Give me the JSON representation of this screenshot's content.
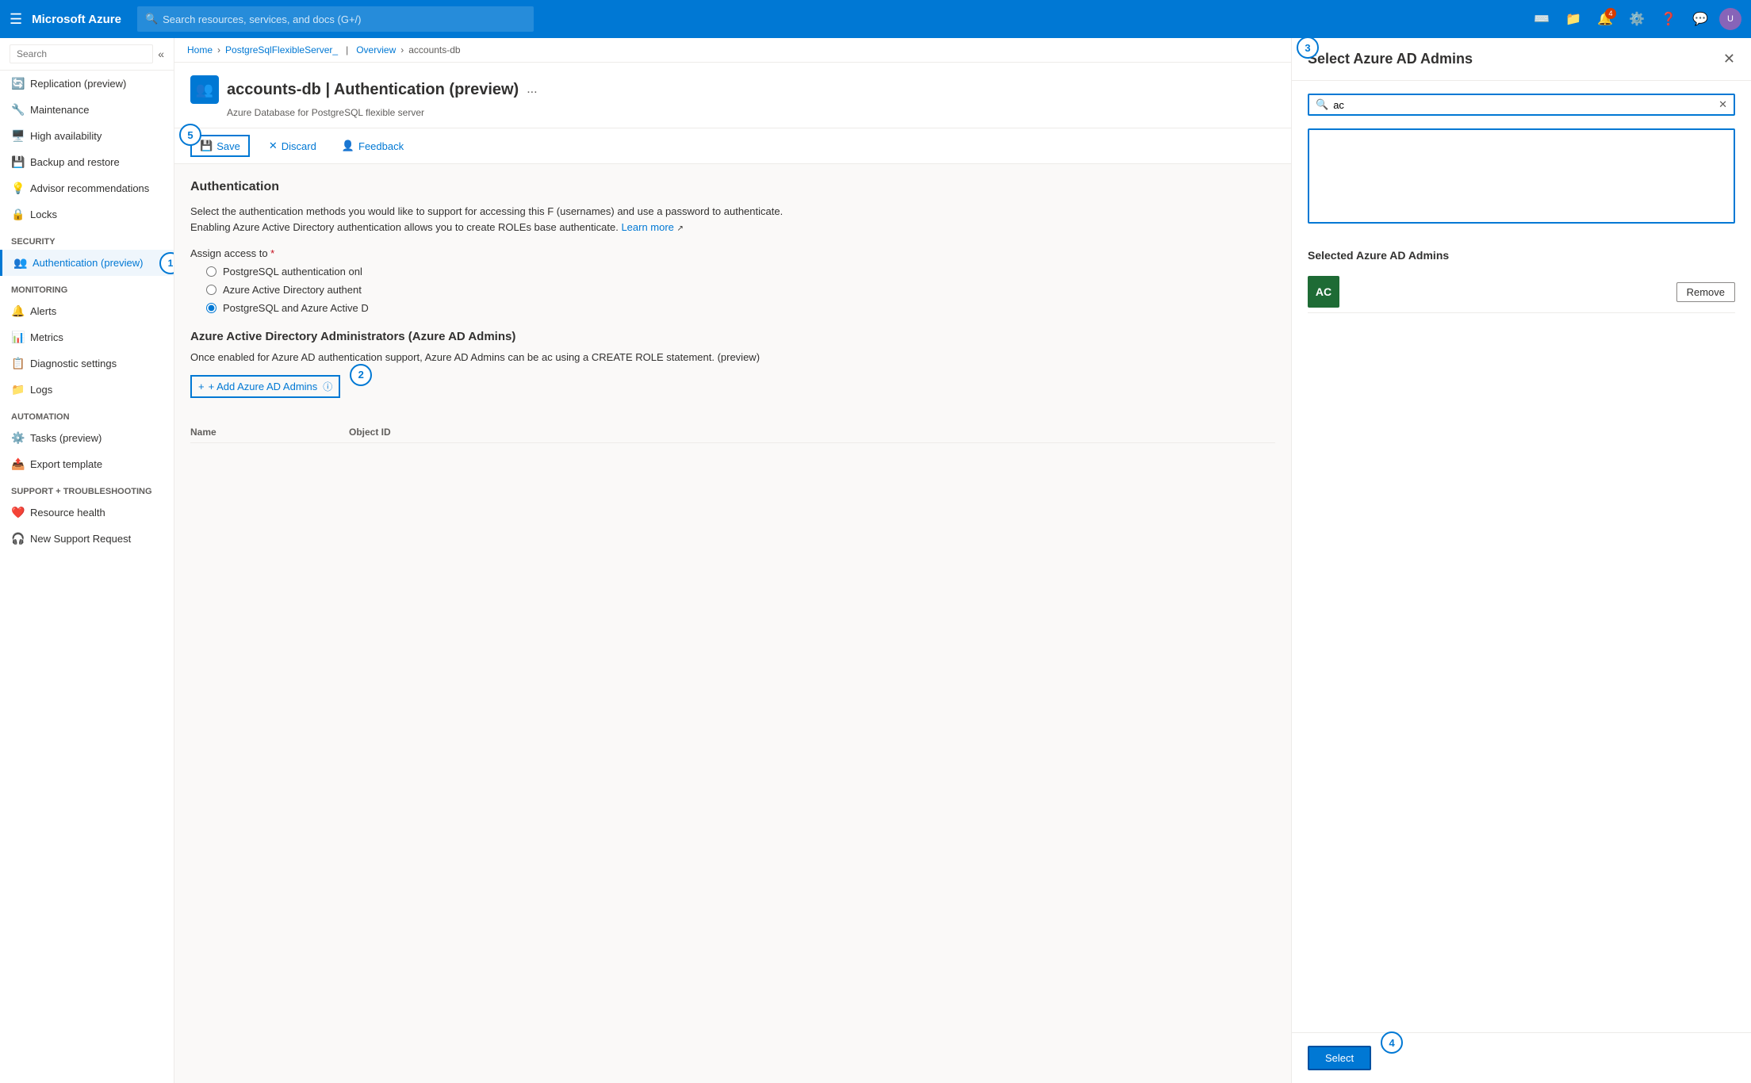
{
  "topnav": {
    "brand": "Microsoft Azure",
    "search_placeholder": "Search resources, services, and docs (G+/)",
    "notification_count": "4"
  },
  "breadcrumb": {
    "home": "Home",
    "server": "PostgreSqlFlexibleServer_",
    "overview": "Overview",
    "db": "accounts-db"
  },
  "resource": {
    "title": "accounts-db | Authentication (preview)",
    "subtitle": "Azure Database for PostgreSQL flexible server",
    "more_label": "..."
  },
  "toolbar": {
    "save_label": "Save",
    "discard_label": "Discard",
    "feedback_label": "Feedback"
  },
  "sidebar": {
    "search_placeholder": "Search",
    "items_top": [
      {
        "id": "replication",
        "label": "Replication (preview)",
        "icon": "🔄"
      },
      {
        "id": "maintenance",
        "label": "Maintenance",
        "icon": "🔧"
      },
      {
        "id": "high-availability",
        "label": "High availability",
        "icon": "🖥️"
      },
      {
        "id": "backup",
        "label": "Backup and restore",
        "icon": "💾"
      },
      {
        "id": "advisor",
        "label": "Advisor recommendations",
        "icon": "💡"
      },
      {
        "id": "locks",
        "label": "Locks",
        "icon": "🔒"
      }
    ],
    "security_section": "Security",
    "security_items": [
      {
        "id": "authentication",
        "label": "Authentication (preview)",
        "icon": "👥",
        "active": true
      }
    ],
    "monitoring_section": "Monitoring",
    "monitoring_items": [
      {
        "id": "alerts",
        "label": "Alerts",
        "icon": "🔔"
      },
      {
        "id": "metrics",
        "label": "Metrics",
        "icon": "📊"
      },
      {
        "id": "diagnostic",
        "label": "Diagnostic settings",
        "icon": "📋"
      },
      {
        "id": "logs",
        "label": "Logs",
        "icon": "📁"
      }
    ],
    "automation_section": "Automation",
    "automation_items": [
      {
        "id": "tasks",
        "label": "Tasks (preview)",
        "icon": "⚙️"
      },
      {
        "id": "export",
        "label": "Export template",
        "icon": "📤"
      }
    ],
    "support_section": "Support + troubleshooting",
    "support_items": [
      {
        "id": "resource-health",
        "label": "Resource health",
        "icon": "❤️"
      },
      {
        "id": "support",
        "label": "New Support Request",
        "icon": "🎧"
      }
    ]
  },
  "authentication": {
    "section_title": "Authentication",
    "desc1": "Select the authentication methods you would like to support for accessing this F (usernames) and use a password to authenticate.",
    "desc2": "Enabling Azure Active Directory authentication allows you to create ROLEs base authenticate.",
    "learn_more": "Learn more",
    "assign_label": "Assign access to",
    "radio_options": [
      {
        "id": "pg-only",
        "label": "PostgreSQL authentication onl",
        "checked": false
      },
      {
        "id": "aad-only",
        "label": "Azure Active Directory authent",
        "checked": false
      },
      {
        "id": "both",
        "label": "PostgreSQL and Azure Active D",
        "checked": true
      }
    ],
    "ad_section_title": "Azure Active Directory Administrators (Azure AD Admins)",
    "ad_desc": "Once enabled for Azure AD authentication support, Azure AD Admins can be ac using a CREATE ROLE statement. (preview)",
    "add_admin_label": "+ Add Azure AD Admins",
    "table_name_col": "Name",
    "table_objid_col": "Object ID"
  },
  "ad_panel": {
    "title": "Select Azure AD Admins",
    "search_value": "ac",
    "selected_title": "Selected Azure AD Admins",
    "admins": [
      {
        "initials": "AC",
        "name": ""
      }
    ],
    "remove_label": "Remove",
    "select_label": "Select"
  },
  "steps": {
    "s1": "1",
    "s2": "2",
    "s3": "3",
    "s4": "4",
    "s5": "5"
  }
}
